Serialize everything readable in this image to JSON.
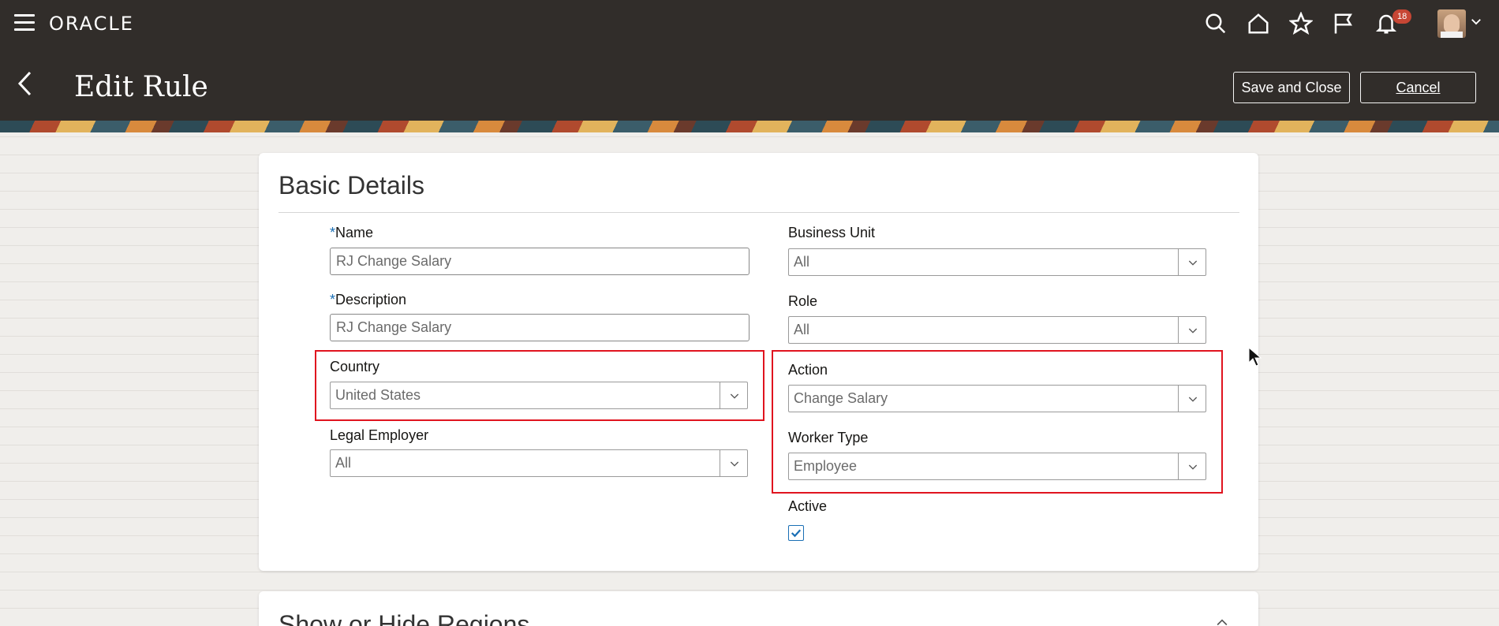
{
  "topbar": {
    "logo": "ORACLE",
    "notifications_count": "18",
    "icons": [
      "search-icon",
      "home-icon",
      "star-icon",
      "flag-icon",
      "bell-icon"
    ]
  },
  "header": {
    "title": "Edit Rule",
    "save_label": "Save and Close",
    "cancel_label": "Cancel"
  },
  "basic_details": {
    "title": "Basic Details",
    "name": {
      "label": "Name",
      "required_mark": "*",
      "value": "RJ Change Salary"
    },
    "description": {
      "label": "Description",
      "required_mark": "*",
      "value": "RJ Change Salary"
    },
    "country": {
      "label": "Country",
      "value": "United States"
    },
    "legal_employer": {
      "label": "Legal Employer",
      "value": "All"
    },
    "business_unit": {
      "label": "Business Unit",
      "value": "All"
    },
    "role": {
      "label": "Role",
      "value": "All"
    },
    "action": {
      "label": "Action",
      "value": "Change Salary"
    },
    "worker_type": {
      "label": "Worker Type",
      "value": "Employee"
    },
    "active": {
      "label": "Active",
      "checked": true
    }
  },
  "show_hide": {
    "title": "Show or Hide Regions"
  },
  "colors": {
    "topbar": "#312d2a",
    "highlight": "#e0141f",
    "accent": "#1a6fb5",
    "badge": "#c74634"
  }
}
